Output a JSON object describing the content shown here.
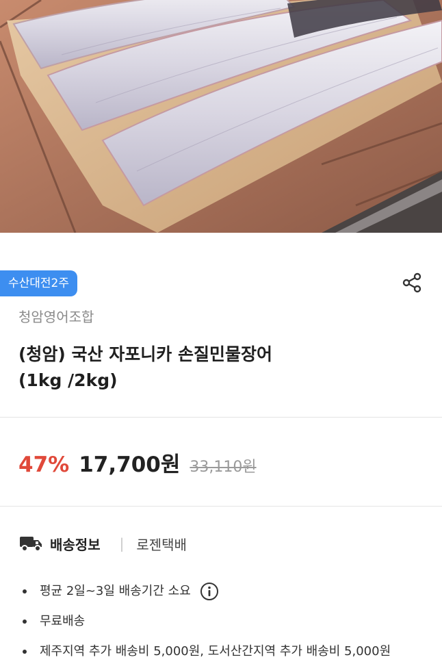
{
  "hero": {
    "image_icon": "grilled-eel-fillets-on-wooden-board-image"
  },
  "badge": {
    "label": "수산대전2주"
  },
  "share": {
    "icon": "share-icon"
  },
  "product": {
    "seller": "청암영어조합",
    "title_line1": "(청암) 국산 자포니카 손질민물장어",
    "title_line2": "(1kg /2kg)"
  },
  "price": {
    "discount": "47%",
    "sale": "17,700원",
    "original": "33,110원",
    "discount_color": "#e0493a"
  },
  "shipping": {
    "icon": "truck-icon",
    "label": "배송정보",
    "separator": "|",
    "carrier": "로젠택배",
    "items": [
      "평균 2일~3일 배송기간 소요",
      "무료배송",
      "제주지역 추가 배송비 5,000원, 도서산간지역 추가 배송비 5,000원"
    ]
  },
  "colors": {
    "badge": "#3d8ef0",
    "accent": "#e0493a"
  }
}
